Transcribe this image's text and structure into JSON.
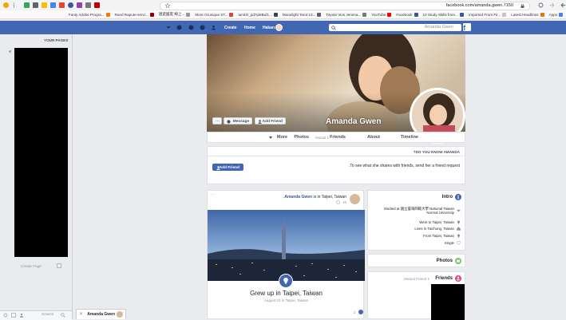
{
  "browser": {
    "url": "facebook.com/amanda.gwen.7150",
    "bookmarks": [
      {
        "label": "Apps",
        "color": "#4285f4"
      },
      {
        "label": "Latest Headlines",
        "color": "#e8710a"
      },
      {
        "label": "Imported From Fir...",
        "color": "#c4c4c4"
      },
      {
        "label": "10 Study Skills from...",
        "color": "#3b5998"
      },
      {
        "label": "Facebook",
        "color": "#3b5998"
      },
      {
        "label": "YouTube",
        "color": "#ff0000"
      },
      {
        "label": "Toyota Vios Jemma...",
        "color": "#777777"
      },
      {
        "label": "Moonlight Tarot 13...",
        "color": "#5f6368"
      },
      {
        "label": "tumblr_pd7pi8Buf1...",
        "color": "#34465d"
      },
      {
        "label": "More Grunique ST...",
        "color": "#db4437"
      },
      {
        "label": "遠遊國度 線上...",
        "color": "#999999"
      },
      {
        "label": "Reed Rapute-servi...",
        "color": "#8b0000"
      },
      {
        "label": "Fanty Adobe Progra...",
        "color": "#ff7700"
      }
    ]
  },
  "fb_header": {
    "search_placeholder": "Amanda Gwen",
    "user_name": "Hakan",
    "home": "Home",
    "create": "Create"
  },
  "sidebar": {
    "title": "YOUR PAGES",
    "create_page": "Create Page"
  },
  "profile": {
    "name": "Amanda Gwen",
    "add_friend": "Add Friend",
    "message": "Message",
    "more_dots": "···"
  },
  "tabs": [
    "Timeline",
    "About",
    "Friends",
    "Photos",
    "More"
  ],
  "tabs_mutual": "1 Mutual",
  "know_card": {
    "title": "DO YOU KNOW AMANDA?",
    "text": "To see what she shares with friends, send her a friend request.",
    "button": "Add Friend"
  },
  "intro": {
    "title": "Intro",
    "items": [
      "Studied at 國立臺灣師範大學 National Taiwan Normal University",
      "Went to Taipei, Taiwan",
      "Lives in Taichung, Taiwan",
      "From Taipei, Taiwan",
      "Single"
    ]
  },
  "photos_title": "Photos",
  "friends": {
    "title": "Friends",
    "mutual": "1 Mutual Friend"
  },
  "post": {
    "author": "Amanda Gwen",
    "action": "is in Taipei, Taiwan.",
    "date": "16",
    "caption": "Grew up in Taipei, Taiwan",
    "sub": "August 20 in Taipei, Taiwan",
    "reactions": "2"
  },
  "chat": {
    "name": "Amanda Gwen",
    "search": "Search"
  },
  "colors": {
    "fb_blue": "#4267b2",
    "page_bg": "#e9ebee"
  }
}
